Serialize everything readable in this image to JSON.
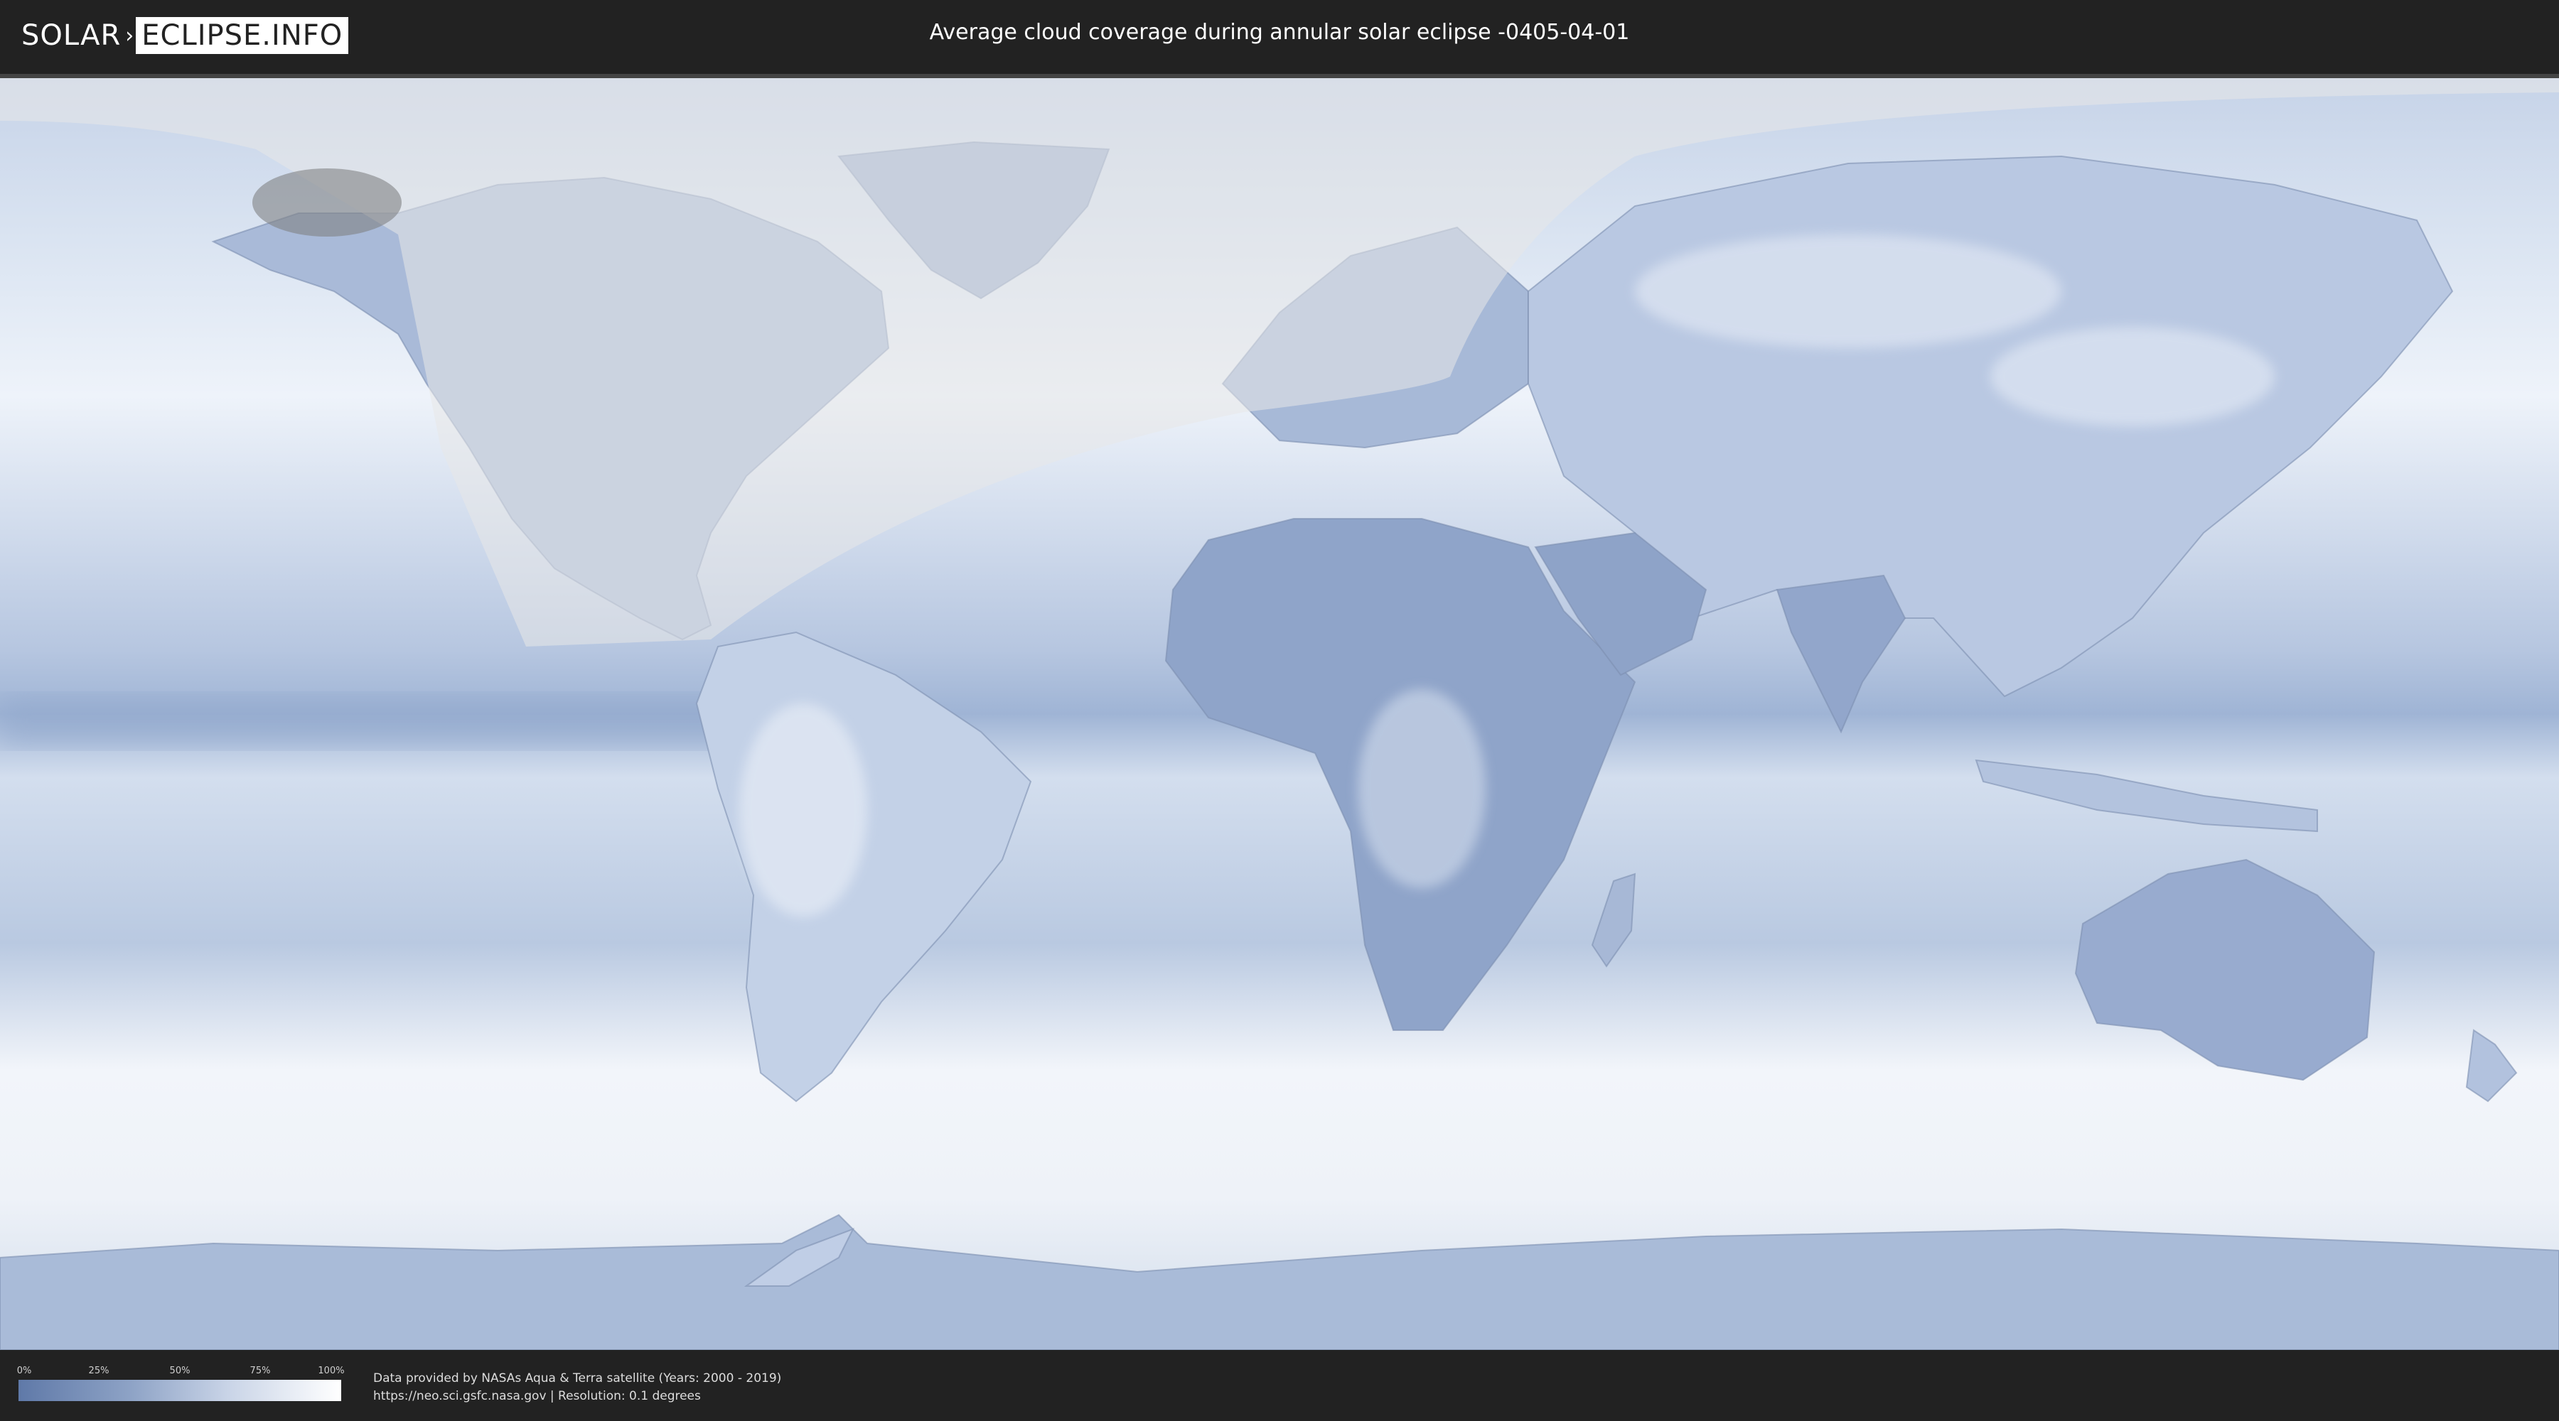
{
  "header": {
    "logo_part1": "SOLAR",
    "logo_part2": "ECLIPSE.INFO",
    "title": "Average cloud coverage during annular solar eclipse -0405-04-01"
  },
  "map": {
    "projection": "equirectangular",
    "colors": {
      "clear_sky": "#5f79a8",
      "full_cloud": "#ffffff",
      "eclipse_region_overlay": "#e6e6e6",
      "header_bg": "#222222"
    }
  },
  "legend": {
    "ticks": [
      "0%",
      "25%",
      "50%",
      "75%",
      "100%"
    ]
  },
  "footer": {
    "credit_line1": "Data provided by NASAs Aqua & Terra satellite (Years: 2000 - 2019)",
    "credit_line2": "https://neo.sci.gsfc.nasa.gov | Resolution: 0.1 degrees"
  }
}
